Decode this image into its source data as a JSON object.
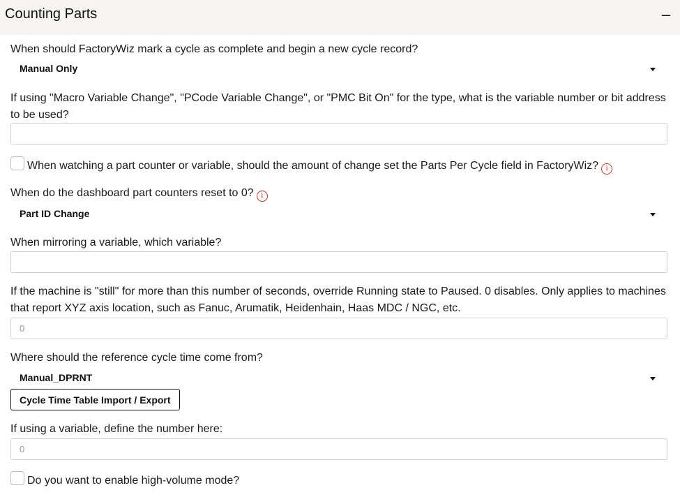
{
  "header": {
    "title": "Counting Parts",
    "collapse_symbol": "–"
  },
  "cycle_complete": {
    "question": "When should FactoryWiz mark a cycle as complete and begin a new cycle record?",
    "selected": "Manual Only"
  },
  "variable_number": {
    "question": "If using \"Macro Variable Change\", \"PCode Variable Change\", or \"PMC Bit On\" for the type, what is the variable number or bit address to be used?",
    "value": ""
  },
  "parts_per_cycle": {
    "label": "When watching a part counter or variable, should the amount of change set the Parts Per Cycle field in FactoryWiz?",
    "checked": false,
    "info_symbol": "i"
  },
  "counter_reset": {
    "question": "When do the dashboard part counters reset to 0?",
    "info_symbol": "i",
    "selected": "Part ID Change"
  },
  "mirror_variable": {
    "question": "When mirroring a variable, which variable?",
    "value": ""
  },
  "still_seconds": {
    "question": "If the machine is \"still\" for more than this number of seconds, override Running state to Paused. 0 disables. Only applies to machines that report XYZ axis location, such as Fanuc, Arumatik, Heidenhain, Haas MDC / NGC, etc.",
    "placeholder": "0"
  },
  "reference_cycle": {
    "question": "Where should the reference cycle time come from?",
    "selected": "Manual_DPRNT",
    "button_label": "Cycle Time Table Import / Export"
  },
  "variable_define": {
    "question": "If using a variable, define the number here:",
    "placeholder": "0"
  },
  "high_volume": {
    "label": "Do you want to enable high-volume mode?",
    "checked": false
  },
  "colors": {
    "header_bg": "#f6f5f2",
    "info_icon": "#c0392b",
    "border": "#cfcfcf"
  }
}
